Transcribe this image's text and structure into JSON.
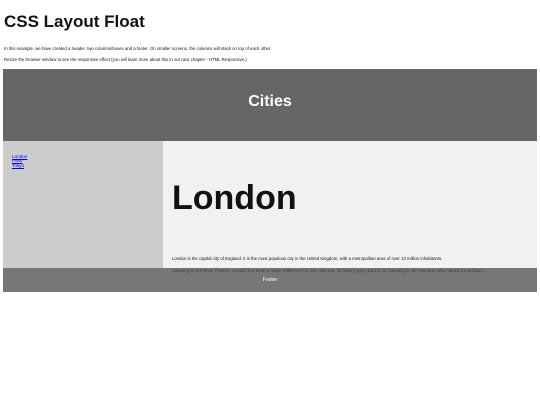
{
  "page": {
    "title": "CSS Layout Float",
    "intro_1": "In this example, we have created a header, two columns/boxes and a footer. On smaller screens, the columns will stack on top of each other.",
    "intro_2": "Resize the browser window to see the responsive effect (you will learn more about this in our next chapter - HTML Responsive.)"
  },
  "header": {
    "title": "Cities"
  },
  "nav": {
    "items": [
      {
        "label": "London"
      },
      {
        "label": "Paris"
      },
      {
        "label": "Tokyo"
      }
    ]
  },
  "article": {
    "title": "London",
    "paragraph_1": "London is the capital city of England. It is the most populous city in the United Kingdom, with a metropolitan area of over 13 million inhabitants.",
    "paragraph_2": "Standing on the River Thames, London has been a major settlement for two millennia, its history going back to its founding by the Romans, who named it Londinium."
  },
  "footer": {
    "text": "Footer"
  },
  "colors": {
    "header_bg": "#666666",
    "nav_bg": "#cccccc",
    "article_bg": "#f1f1f1",
    "footer_bg": "#777777",
    "link": "#0000ee"
  }
}
